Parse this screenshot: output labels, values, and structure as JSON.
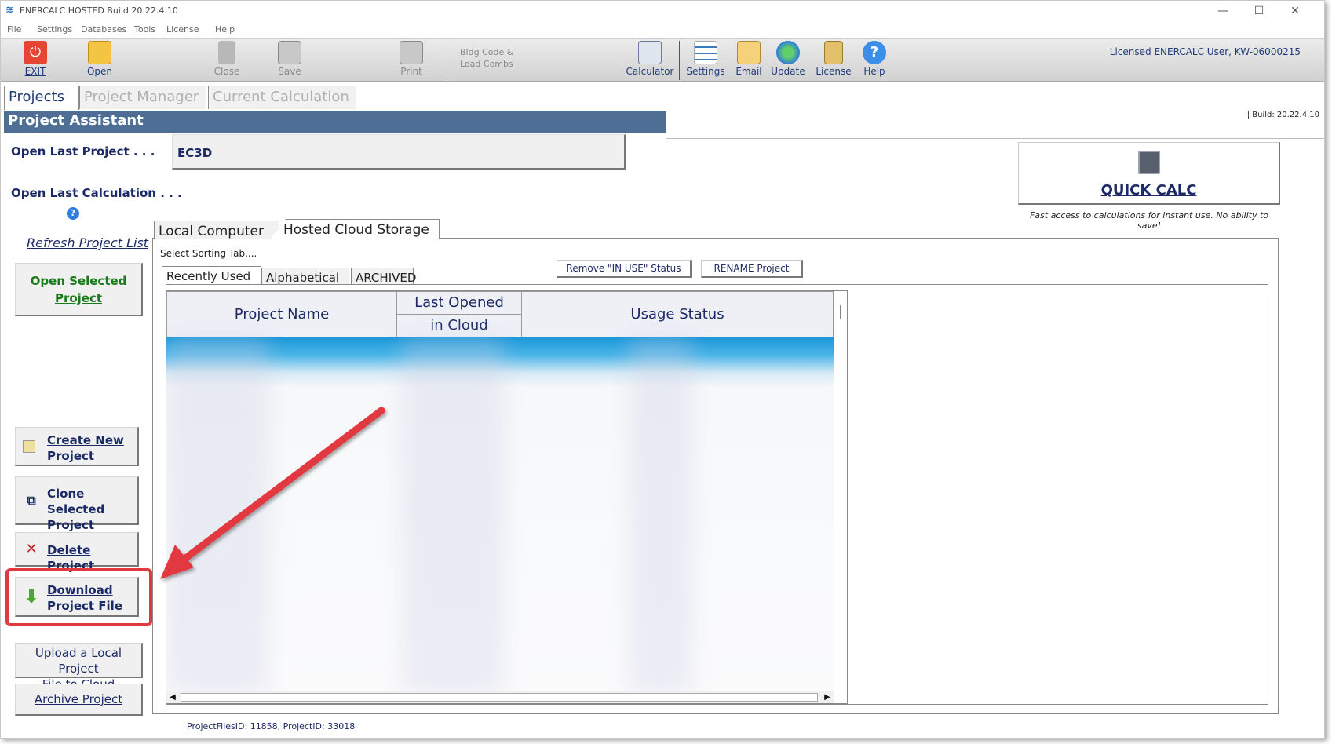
{
  "window": {
    "title": "ENERCALC HOSTED Build 20.22.4.10",
    "controls": {
      "minimize": "—",
      "maximize": "☐",
      "close": "✕"
    }
  },
  "menu": {
    "items": [
      "File",
      "Settings",
      "Databases",
      "Tools",
      "License",
      "Help"
    ]
  },
  "toolbar": {
    "exit": "EXIT",
    "open": "Open",
    "close": "Close",
    "save": "Save",
    "print": "Print",
    "bldg_line1": "Bldg Code &",
    "bldg_line2": "Load Combs",
    "calculator": "Calculator",
    "settings": "Settings",
    "email": "Email",
    "update": "Update",
    "license": "License",
    "help": "Help",
    "licensed": "Licensed ENERCALC User, KW-06000215"
  },
  "tabs": [
    "Projects",
    "Project Manager",
    "Current Calculation"
  ],
  "assistant": {
    "title": "Project Assistant",
    "build": "| Build: 20.22.4.10",
    "open_last_project": "Open Last Project . . .",
    "last_project_value": "EC3D",
    "open_last_calc": "Open Last Calculation . . .",
    "refresh": "Refresh Project List",
    "open_selected_line1": "Open Selected",
    "open_selected_line2": "Project"
  },
  "quick_calc": {
    "label": "QUICK CALC",
    "note": "Fast access to calculations for instant use. No ability to save!"
  },
  "left_buttons": {
    "create_line1": "Create New",
    "create_line2": "Project",
    "clone_line1": "Clone Selected",
    "clone_line2": "Project",
    "delete": "Delete Project",
    "download_line1": "Download",
    "download_line2": "Project File",
    "upload_line1": "Upload a Local Project",
    "upload_line2": "File to Cloud",
    "archive": "Archive Project"
  },
  "storage_tabs": [
    "Local Computer",
    "Hosted Cloud Storage"
  ],
  "sorting": {
    "label": "Select Sorting Tab....",
    "tabs": [
      "Recently Used",
      "Alphabetical",
      "ARCHIVED"
    ]
  },
  "actions": {
    "remove_in_use": "Remove \"IN USE\" Status",
    "rename": "RENAME Project"
  },
  "grid": {
    "columns": {
      "project_name": "Project Name",
      "last_opened_line1": "Last Opened",
      "last_opened_line2": "in Cloud",
      "usage_status": "Usage Status"
    }
  },
  "footer": {
    "ids": "ProjectFilesID: 11858,  ProjectID: 33018"
  },
  "colors": {
    "header_blue": "#4e6e95",
    "text_navy": "#1b2a66",
    "highlight_red": "#e2393f",
    "open_green": "#1a7a1a"
  }
}
